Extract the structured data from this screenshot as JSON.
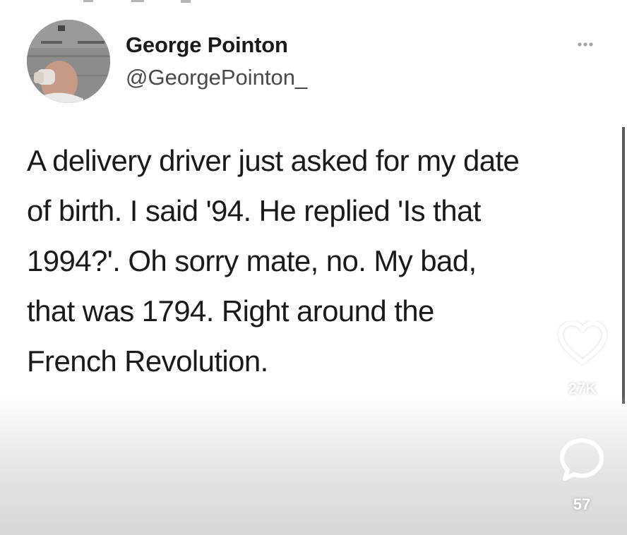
{
  "author": {
    "display_name": "George Pointon",
    "handle": "@GeorgePointon_"
  },
  "tweet": {
    "text": "A delivery driver just asked for my date\nof birth. I said '94. He replied 'Is that\n1994?'. Oh sorry mate, no. My bad,\nthat was 1794. Right around the\nFrench Revolution."
  },
  "actions": {
    "likes": "27K",
    "comments": "57"
  },
  "icons": {
    "more": "more-options-icon",
    "like": "heart-icon",
    "comment": "comment-bubble-icon"
  },
  "colors": {
    "background": "#ffffff",
    "text": "#1a1a1a",
    "handle": "#4a4a4a"
  }
}
